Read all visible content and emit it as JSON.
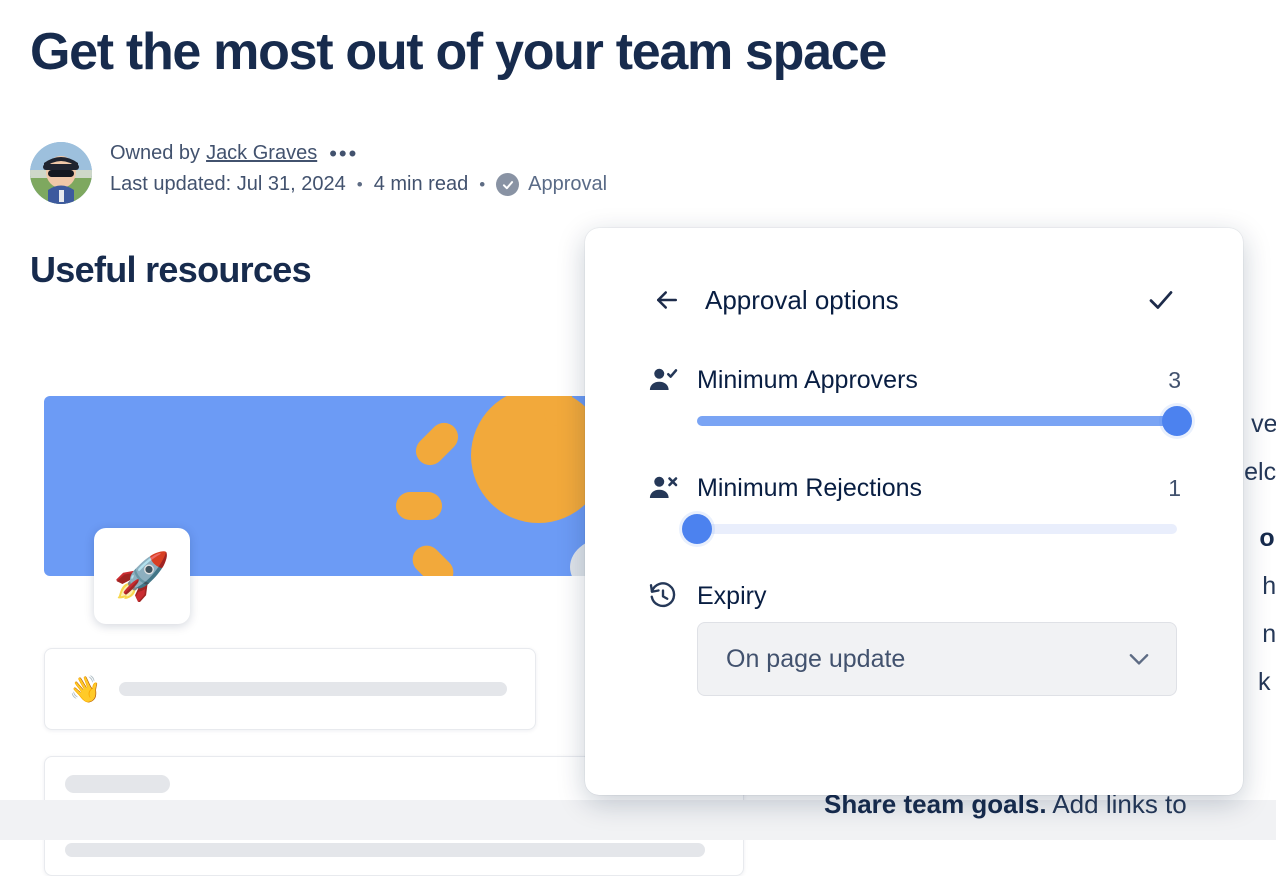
{
  "page": {
    "title": "Get the most out of your team space",
    "byline": {
      "owned_by_label": "Owned by",
      "owner_name": "Jack Graves",
      "more_actions": "•••",
      "last_updated": "Last updated: Jul 31, 2024",
      "separator": "•",
      "read_time": "4 min read",
      "status_label": "Approval"
    },
    "section_title": "Useful resources",
    "right_column_lines": [
      "ves",
      "elco",
      "or. ",
      "he",
      "ne",
      "k y"
    ],
    "right_lower_bold": "Share team goals.",
    "right_lower_text": " Add links to",
    "card_emojis": {
      "rocket": "🚀",
      "wave": "👋"
    }
  },
  "popup": {
    "title": "Approval options",
    "back_label": "Back",
    "confirm_label": "Confirm",
    "options": [
      {
        "id": "minimum-approvers",
        "icon": "person-check-icon",
        "label": "Minimum Approvers",
        "value": "3",
        "slider": {
          "percent": 100,
          "min": 1,
          "max": 3
        }
      },
      {
        "id": "minimum-rejections",
        "icon": "person-x-icon",
        "label": "Minimum Rejections",
        "value": "1",
        "slider": {
          "percent": 0,
          "min": 1,
          "max": 3
        }
      }
    ],
    "expiry": {
      "icon": "history-icon",
      "label": "Expiry",
      "selected": "On page update"
    }
  },
  "colors": {
    "accent_blue": "#4c82ef",
    "track_fill": "#7aa4f4",
    "track_empty": "#e9eefc",
    "text_dark": "#091e42",
    "text_muted": "#42526e",
    "banner_blue": "#6c9bf5",
    "sun_orange": "#f2a93b"
  }
}
